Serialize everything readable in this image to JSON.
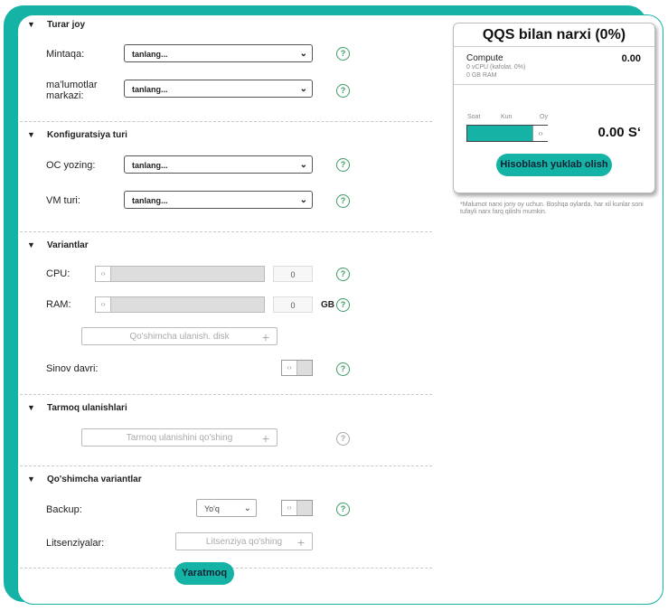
{
  "sections": {
    "location": {
      "title": "Turar joy",
      "region_label": "Mintaqa:",
      "region_value": "tanlang...",
      "datacenter_label_1": "ma'lumotlar",
      "datacenter_label_2": "markazi:",
      "datacenter_value": "tanlang..."
    },
    "config": {
      "title": "Konfiguratsiya turi",
      "os_label": "OC yozing:",
      "os_value": "tanlang...",
      "vm_label": "VM turi:",
      "vm_value": "tanlang..."
    },
    "options": {
      "title": "Variantlar",
      "cpu_label": "CPU:",
      "cpu_value": "0",
      "ram_label": "RAM:",
      "ram_value": "0",
      "ram_unit": "GB",
      "disk_button": "Qo'shimcha ulanish. disk",
      "trial_label": "Sinov davri:"
    },
    "network": {
      "title": "Tarmoq ulanishlari",
      "add_button": "Tarmoq ulanishini qo'shing"
    },
    "extra": {
      "title": "Qo'shimcha variantlar",
      "backup_label": "Backup:",
      "backup_value": "Yo'q",
      "license_label": "Litsenziyalar:",
      "license_button": "Litsenziya qo'shing"
    }
  },
  "create_button": "Yaratmoq",
  "price": {
    "title": "QQS bilan narxi (0%)",
    "compute_label": "Compute",
    "compute_value": "0.00",
    "vcpu_detail": "0 vCPU (kafolat. 0%)",
    "ram_detail": "0 GB RAM",
    "period_hour": "Soat",
    "period_day": "Kun",
    "period_month": "Oy",
    "selected_period_position": 1.0,
    "total": "0.00 S‘",
    "download_button": "Hisoblash yuklab olish",
    "footnote": "*Malumot narxi joriy oy uchun. Boshqa oylarda, har xil kunlar soni tufayli narx farq qilishi mumkin."
  },
  "colors": {
    "accent": "#14b3a6",
    "help": "#3a9c63"
  },
  "icons": {
    "collapse": "triangle-down-icon",
    "help": "question-circle-icon",
    "plus": "plus-icon",
    "slider": "slider-handle-icon"
  }
}
